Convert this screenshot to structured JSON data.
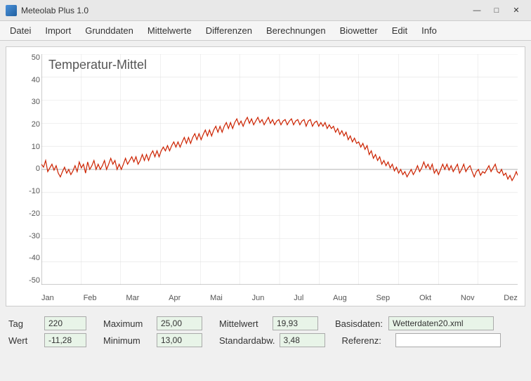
{
  "app": {
    "title": "Meteolab Plus 1.0",
    "icon_label": "app-icon"
  },
  "titlebar": {
    "minimize": "—",
    "maximize": "□",
    "close": "✕"
  },
  "menu": {
    "items": [
      "Datei",
      "Import",
      "Grunddaten",
      "Mittelwerte",
      "Differenzen",
      "Berechnungen",
      "Biowetter",
      "Edit",
      "Info"
    ]
  },
  "chart": {
    "title": "Temperatur-Mittel",
    "y_labels": [
      "50",
      "40",
      "30",
      "20",
      "10",
      "0",
      "-10",
      "-20",
      "-30",
      "-40",
      "-50"
    ],
    "x_labels": [
      "Jan",
      "Feb",
      "Mar",
      "Apr",
      "Mai",
      "Jun",
      "Jul",
      "Aug",
      "Sep",
      "Okt",
      "Nov",
      "Dez"
    ]
  },
  "fields": {
    "tag_label": "Tag",
    "tag_value": "220",
    "wert_label": "Wert",
    "wert_value": "-11,28",
    "maximum_label": "Maximum",
    "maximum_value": "25,00",
    "minimum_label": "Minimum",
    "minimum_value": "13,00",
    "mittelwert_label": "Mittelwert",
    "mittelwert_value": "19,93",
    "standardabw_label": "Standardabw.",
    "standardabw_value": "3,48",
    "basisdaten_label": "Basisdaten:",
    "basisdaten_value": "Wetterdaten20.xml",
    "referenz_label": "Referenz:",
    "referenz_value": ""
  }
}
